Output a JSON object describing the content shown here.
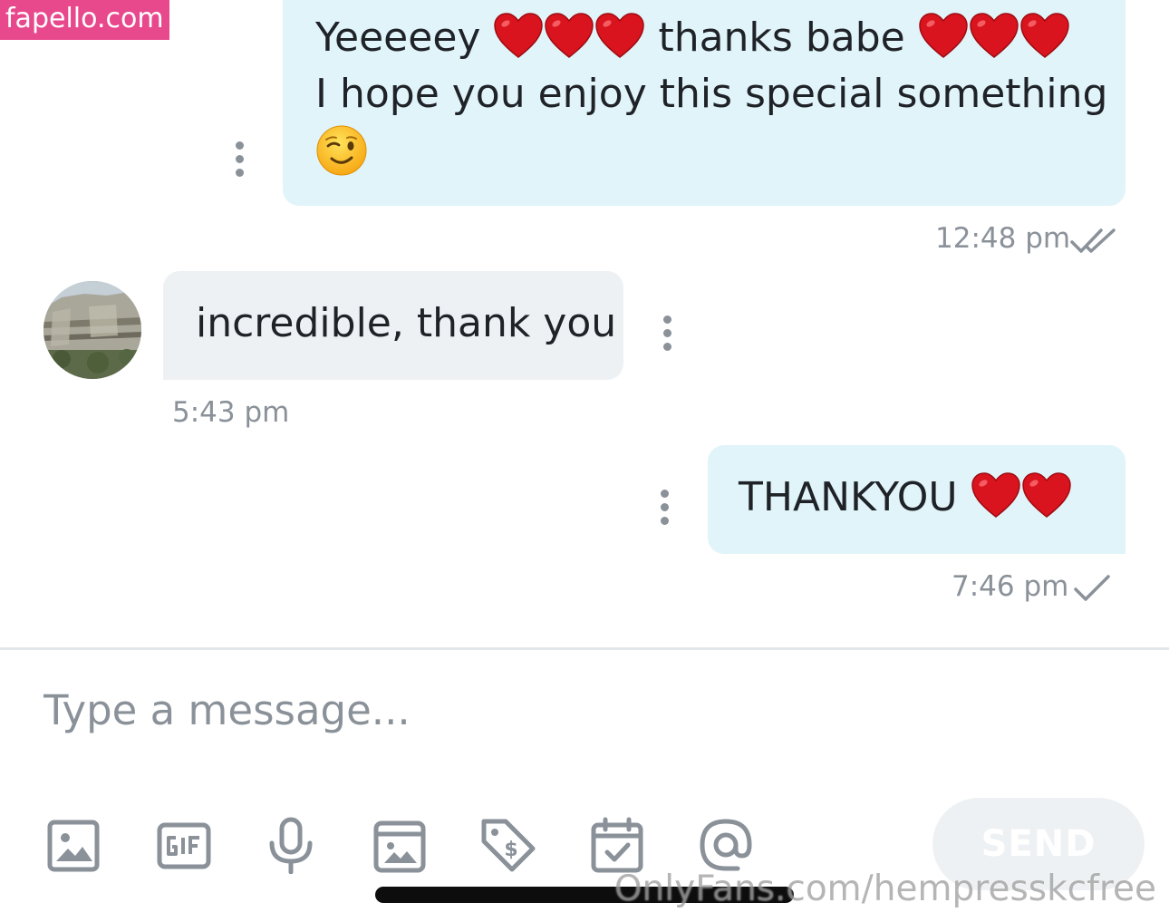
{
  "watermarks": {
    "top": "fapello.com",
    "bottom": "OnlyFans.com/hempresskcfree"
  },
  "messages": [
    {
      "direction": "outgoing",
      "line1_start": "Yeeeeey",
      "line1_mid": "thanks babe",
      "line2": "I hope you enjoy this special something",
      "time": "12:48 pm",
      "status_icon": "double-check-icon"
    },
    {
      "direction": "incoming",
      "text": "incredible, thank you",
      "time": "5:43 pm"
    },
    {
      "direction": "outgoing",
      "text": "THANKYOU",
      "time": "7:46 pm",
      "status_icon": "single-check-icon"
    }
  ],
  "composer": {
    "placeholder": "Type a message..."
  },
  "toolbar": {
    "icons": [
      "image-icon",
      "gif-icon",
      "microphone-icon",
      "vault-icon",
      "price-tag-icon",
      "schedule-icon",
      "mention-icon"
    ],
    "send_label": "SEND"
  },
  "colors": {
    "outgoing_bubble": "#e0f4fa",
    "incoming_bubble": "#eef1f3",
    "muted_text": "#8a9199",
    "heart": "#d9141e",
    "watermark_pink": "#e8488c"
  }
}
